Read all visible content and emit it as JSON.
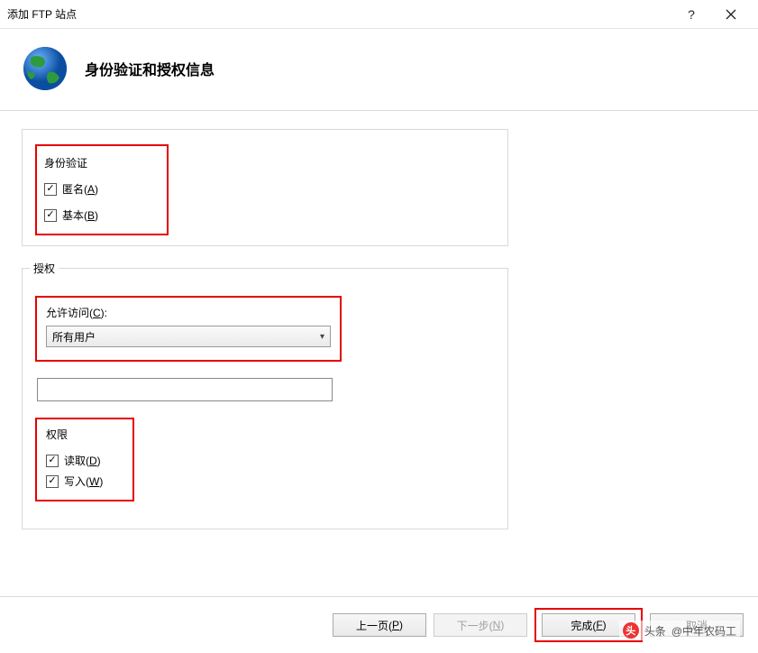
{
  "window": {
    "title": "添加 FTP 站点"
  },
  "header": {
    "title": "身份验证和授权信息"
  },
  "auth": {
    "legend": "身份验证",
    "anon_label": "匿名(",
    "anon_hotkey": "A",
    "anon_close": ")",
    "basic_label": "基本(",
    "basic_hotkey": "B",
    "basic_close": ")"
  },
  "authz": {
    "legend": "授权",
    "access_label": "允许访问(",
    "access_hotkey": "C",
    "access_close": "):",
    "selected": "所有用户"
  },
  "perm": {
    "legend": "权限",
    "read_label": "读取(",
    "read_hotkey": "D",
    "read_close": ")",
    "write_label": "写入(",
    "write_hotkey": "W",
    "write_close": ")"
  },
  "footer": {
    "prev": "上一页(",
    "prev_hotkey": "P",
    "prev_close": ")",
    "next": "下一步(",
    "next_hotkey": "N",
    "next_close": ")",
    "finish": "完成(",
    "finish_hotkey": "F",
    "finish_close": ")",
    "cancel": "取消"
  },
  "watermark": {
    "prefix": "头条",
    "author": "@中年农码工"
  }
}
